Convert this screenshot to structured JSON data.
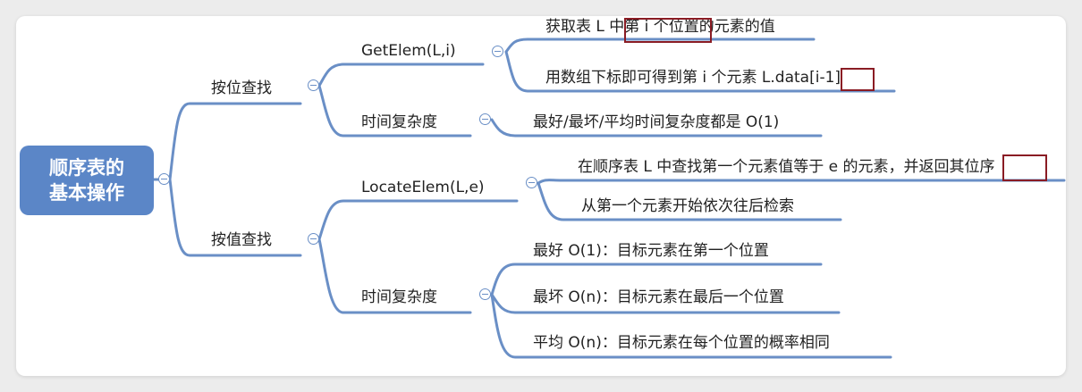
{
  "root": {
    "line1": "顺序表的",
    "line2": "基本操作"
  },
  "by_position": {
    "label": "按位查找",
    "getelem": {
      "label": "GetElem(L,i)",
      "desc1": "获取表 L 中第 i 个位置的元素的值",
      "desc2": "用数组下标即可得到第 i 个元素 L.data[i-1]"
    },
    "time": {
      "label": "时间复杂度",
      "desc": "最好/最坏/平均时间复杂度都是 O(1)"
    }
  },
  "by_value": {
    "label": "按值查找",
    "locate": {
      "label": "LocateElem(L,e)",
      "desc1": "在顺序表 L 中查找第一个元素值等于 e 的元素，并返回其位序",
      "desc2": "从第一个元素开始依次往后检索"
    },
    "time": {
      "label": "时间复杂度",
      "best": "最好 O(1)：目标元素在第一个位置",
      "worst": "最坏 O(n)：目标元素在最后一个位置",
      "avg": "平均 O(n)：目标元素在每个位置的概率相同"
    }
  },
  "colors": {
    "root": "#5b86c7",
    "edge": "#6a8fc6",
    "highlight": "#8a1c24"
  },
  "icons": {
    "toggle": "collapse-minus-icon"
  }
}
